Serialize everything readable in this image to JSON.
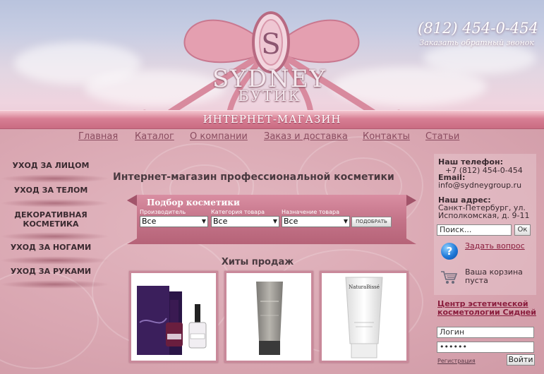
{
  "header": {
    "phone": "(812) 454-0-454",
    "callback": "Заказать обратный звонок",
    "logo_letter": "S",
    "logo_name": "SYDNEY",
    "logo_sub": "БУТИК",
    "shop_label": "ИНТЕРНЕТ-МАГАЗИН"
  },
  "topnav": [
    {
      "label": "Главная"
    },
    {
      "label": "Каталог"
    },
    {
      "label": "О компании"
    },
    {
      "label": "Заказ и доставка"
    },
    {
      "label": "Контакты"
    },
    {
      "label": "Статьи"
    }
  ],
  "left_menu": [
    {
      "label": "УХОД ЗА ЛИЦОМ"
    },
    {
      "label": "УХОД ЗА ТЕЛОМ"
    },
    {
      "label": "ДЕКОРАТИВНАЯ КОСМЕТИКА"
    },
    {
      "label": "УХОД ЗА НОГАМИ"
    },
    {
      "label": "УХОД ЗА РУКАМИ"
    }
  ],
  "main": {
    "title": "Интернет-магазин профессиональной косметики",
    "filter": {
      "title": "Подбор косметики",
      "fields": [
        {
          "label": "Производитель",
          "value": "Все"
        },
        {
          "label": "Категория товара",
          "value": "Все"
        },
        {
          "label": "Назначение товара",
          "value": "Все"
        }
      ],
      "button": "ПОДОБРАТЬ"
    },
    "hits_title": "Хиты продаж",
    "products": [
      {
        "name": "nail-polish-kit"
      },
      {
        "name": "gray-tube"
      },
      {
        "name": "white-tube",
        "brand": "NaturaBissé"
      }
    ]
  },
  "right": {
    "phone_label": "Наш телефон:",
    "phone_value": "+7 (812) 454-0-454",
    "email_label": "Email:",
    "email_value": "info@sydneygroup.ru",
    "address_label": "Наш адрес:",
    "address_line1": "Санкт-Петербург, ул.",
    "address_line2": "Исполкомская, д. 9-11",
    "search_placeholder": "Поиск...",
    "search_button": "Ок",
    "ask_link": "Задать вопрос",
    "cart_text": "Ваша корзина пуста",
    "center_link": "Центр эстетической косметологии Сидней",
    "login_value": "Логин",
    "password_value": "••••••",
    "register_link": "Регистрация",
    "login_button": "Войти"
  },
  "colors": {
    "background": "#d7a4ae",
    "ribbon": "#d88a9e",
    "link": "#8a4c60",
    "accent_link": "#8a1d3d"
  }
}
